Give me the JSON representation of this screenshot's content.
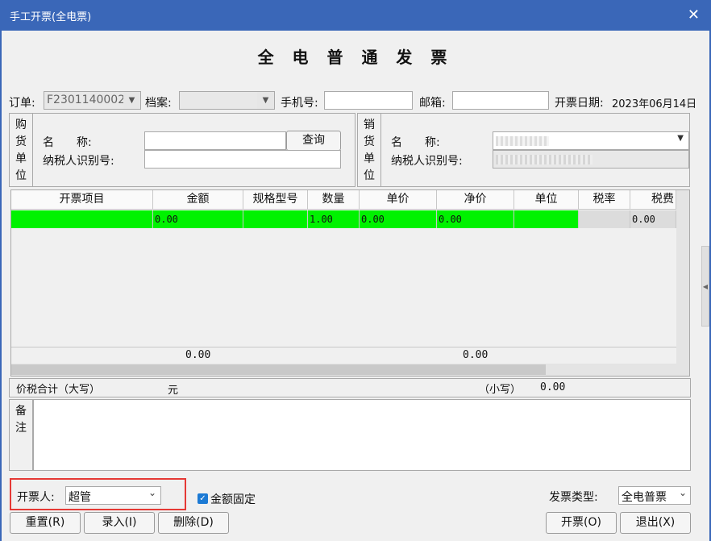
{
  "window": {
    "title": "手工开票(全电票)",
    "close_icon": "close-icon"
  },
  "heading": "全 电 普 通 发 票",
  "top": {
    "order_label": "订单:",
    "order_value": "F2301140002",
    "archive_label": "档案:",
    "archive_value": "",
    "phone_label": "手机号:",
    "phone_value": "",
    "email_label": "邮箱:",
    "email_value": "",
    "date_label": "开票日期:",
    "date_value": "2023年06月14日"
  },
  "buyer": {
    "side_label": [
      "购",
      "货",
      "单",
      "位"
    ],
    "name_label": "名　　称:",
    "name_value": "",
    "query_button": "查询",
    "taxid_label": "纳税人识别号:",
    "taxid_value": ""
  },
  "seller": {
    "side_label": [
      "销",
      "货",
      "单",
      "位"
    ],
    "name_label": "名　　称:",
    "taxid_label": "纳税人识别号:"
  },
  "grid": {
    "columns": [
      "开票项目",
      "金额",
      "规格型号",
      "数量",
      "单价",
      "净价",
      "单位",
      "税率",
      "税费"
    ],
    "rows": [
      [
        "",
        "0.00",
        "",
        "1.00",
        "0.00",
        "0.00",
        "",
        "",
        "0.00"
      ]
    ],
    "totals": {
      "amount": "0.00",
      "net": "0.00"
    }
  },
  "summary": {
    "total_label": "价税合计（大写）",
    "currency": "元",
    "small_label": "（小写）",
    "small_value": "0.00"
  },
  "remark": {
    "label": [
      "备",
      "注"
    ]
  },
  "footer": {
    "issuer_label": "开票人:",
    "issuer_value": "超管",
    "fixed_amount_label": "金额固定",
    "invoice_type_label": "发票类型:",
    "invoice_type_value": "全电普票",
    "buttons": {
      "reset": "重置(R)",
      "entry": "录入(I)",
      "delete": "删除(D)",
      "issue": "开票(O)",
      "exit": "退出(X)"
    }
  },
  "colors": {
    "accent": "#3a67b8",
    "row_highlight": "#00f200",
    "focus_box": "#e53935"
  }
}
